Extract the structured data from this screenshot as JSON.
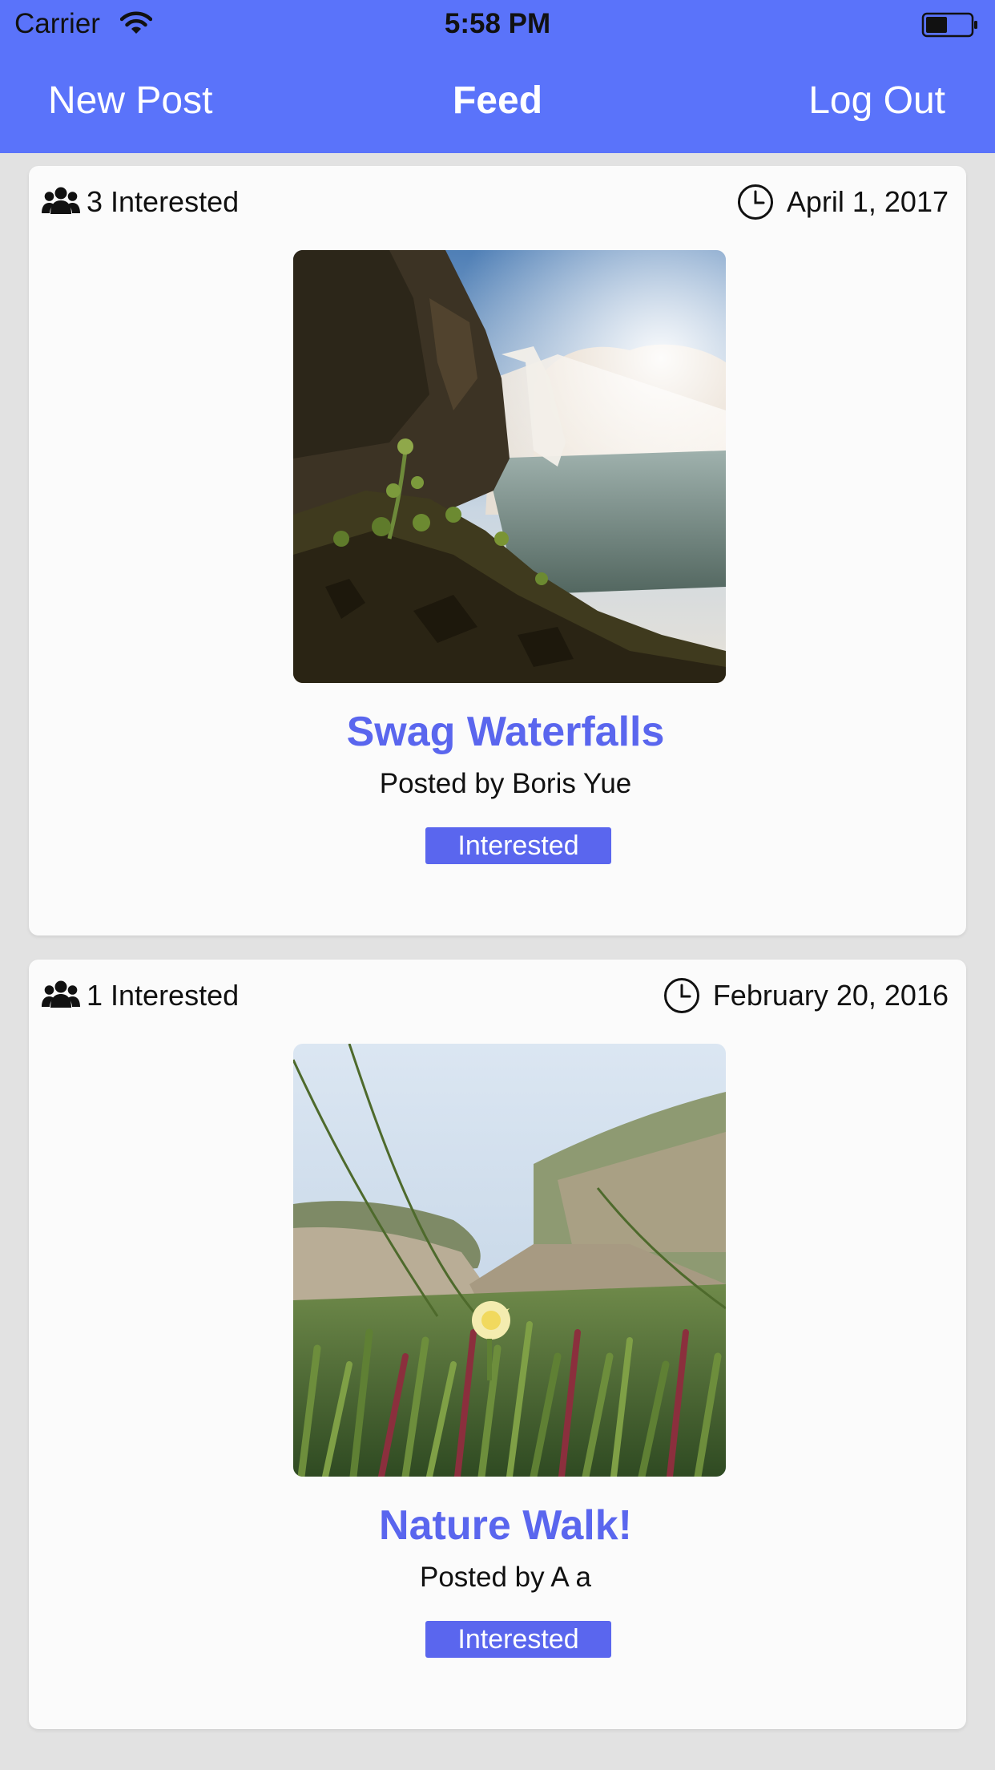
{
  "status_bar": {
    "carrier": "Carrier",
    "time": "5:58 PM",
    "icons": [
      "wifi-icon",
      "battery-icon"
    ]
  },
  "nav": {
    "left_label": "New Post",
    "title": "Feed",
    "right_label": "Log Out",
    "color": "#5a73fa"
  },
  "posts": [
    {
      "interested_count": "3 Interested",
      "date": "April 1, 2017",
      "title": "Swag Waterfalls",
      "author": "Posted by Boris Yue",
      "button_label": "Interested",
      "photo": "waterfall-photo"
    },
    {
      "interested_count": "1 Interested",
      "date": "February 20, 2016",
      "title": "Nature Walk!",
      "author": "Posted by A a",
      "button_label": "Interested",
      "photo": "beach-flower-photo"
    }
  ],
  "colors": {
    "accent": "#5a66ee",
    "background": "#e2e2e2",
    "card": "#fbfbfb"
  }
}
